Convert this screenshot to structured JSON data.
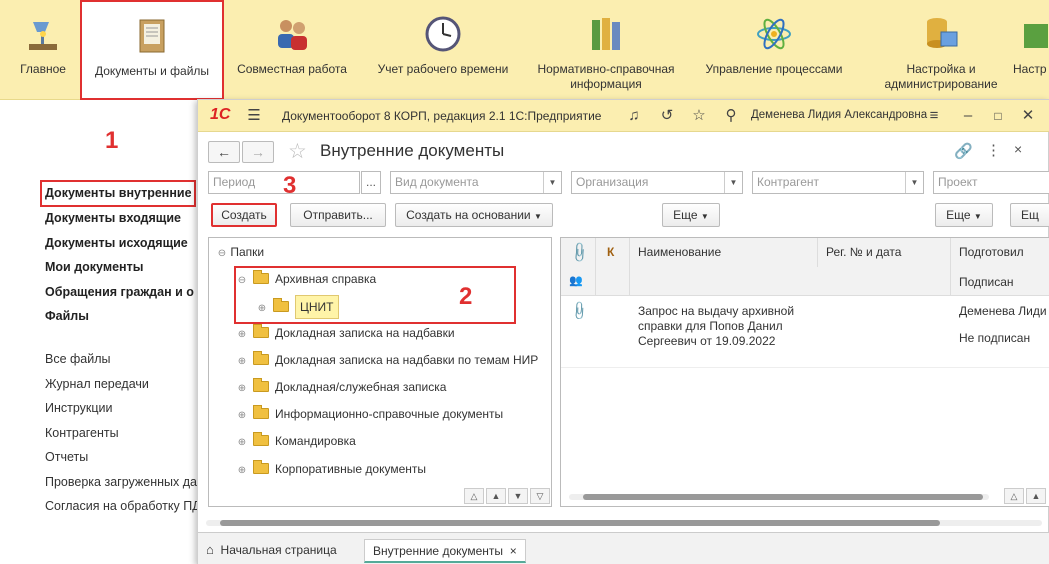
{
  "ribbon": {
    "items": [
      {
        "label": "Главное"
      },
      {
        "label": "Документы и файлы"
      },
      {
        "label": "Совместная работа"
      },
      {
        "label": "Учет рабочего времени"
      },
      {
        "label": "Нормативно-справочная информация"
      },
      {
        "label": "Управление процессами"
      },
      {
        "label": "Настройка и администрирование"
      },
      {
        "label": "Настр"
      }
    ]
  },
  "sidebar": {
    "bold_items": [
      "Документы внутренние",
      "Документы входящие",
      "Документы исходящие",
      "Мои документы",
      "Обращения граждан и о",
      "Файлы"
    ],
    "items": [
      "Все файлы",
      "Журнал передачи",
      "Инструкции",
      "Контрагенты",
      "Отчеты",
      "Проверка загруженных да",
      "Согласия на обработку ПД"
    ]
  },
  "annotations": {
    "n1": "1",
    "n2": "2",
    "n3": "3"
  },
  "window": {
    "logo": "1С",
    "title": "Документооборот 8 КОРП, редакция 2.1 1С:Предприятие",
    "user": "Деменева Лидия Александровна",
    "form_title": "Внутренние документы"
  },
  "filters": {
    "period": "Период",
    "period_btn": "...",
    "doc_type": "Вид документа",
    "organization": "Организация",
    "counterparty": "Контрагент",
    "project": "Проект"
  },
  "buttons": {
    "create": "Создать",
    "send": "Отправить...",
    "create_based": "Создать на основании",
    "more1": "Еще",
    "more2": "Еще",
    "more3": "Ещ"
  },
  "tree": {
    "root": "Папки",
    "items": [
      "Архивная справка",
      "ЦНИТ",
      "Докладная записка на надбавки",
      "Докладная записка на надбавки по темам НИР",
      "Докладная/служебная записка",
      "Информационно-справочные документы",
      "Командировка",
      "Корпоративные документы"
    ]
  },
  "list": {
    "headers": {
      "k": "К",
      "name": "Наименование",
      "reg": "Рег. № и дата",
      "prepared": "Подготовил",
      "signed": "Подписан"
    },
    "rows": [
      {
        "name_line1": "Запрос на выдачу архивной",
        "name_line2": "справки для Попов Данил",
        "name_line3": "Сергеевич от 19.09.2022",
        "prepared": "Деменева Лиди",
        "signed": "Не подписан"
      }
    ]
  },
  "bottom_tabs": {
    "home": "Начальная страница",
    "current": "Внутренние документы",
    "close": "×"
  }
}
